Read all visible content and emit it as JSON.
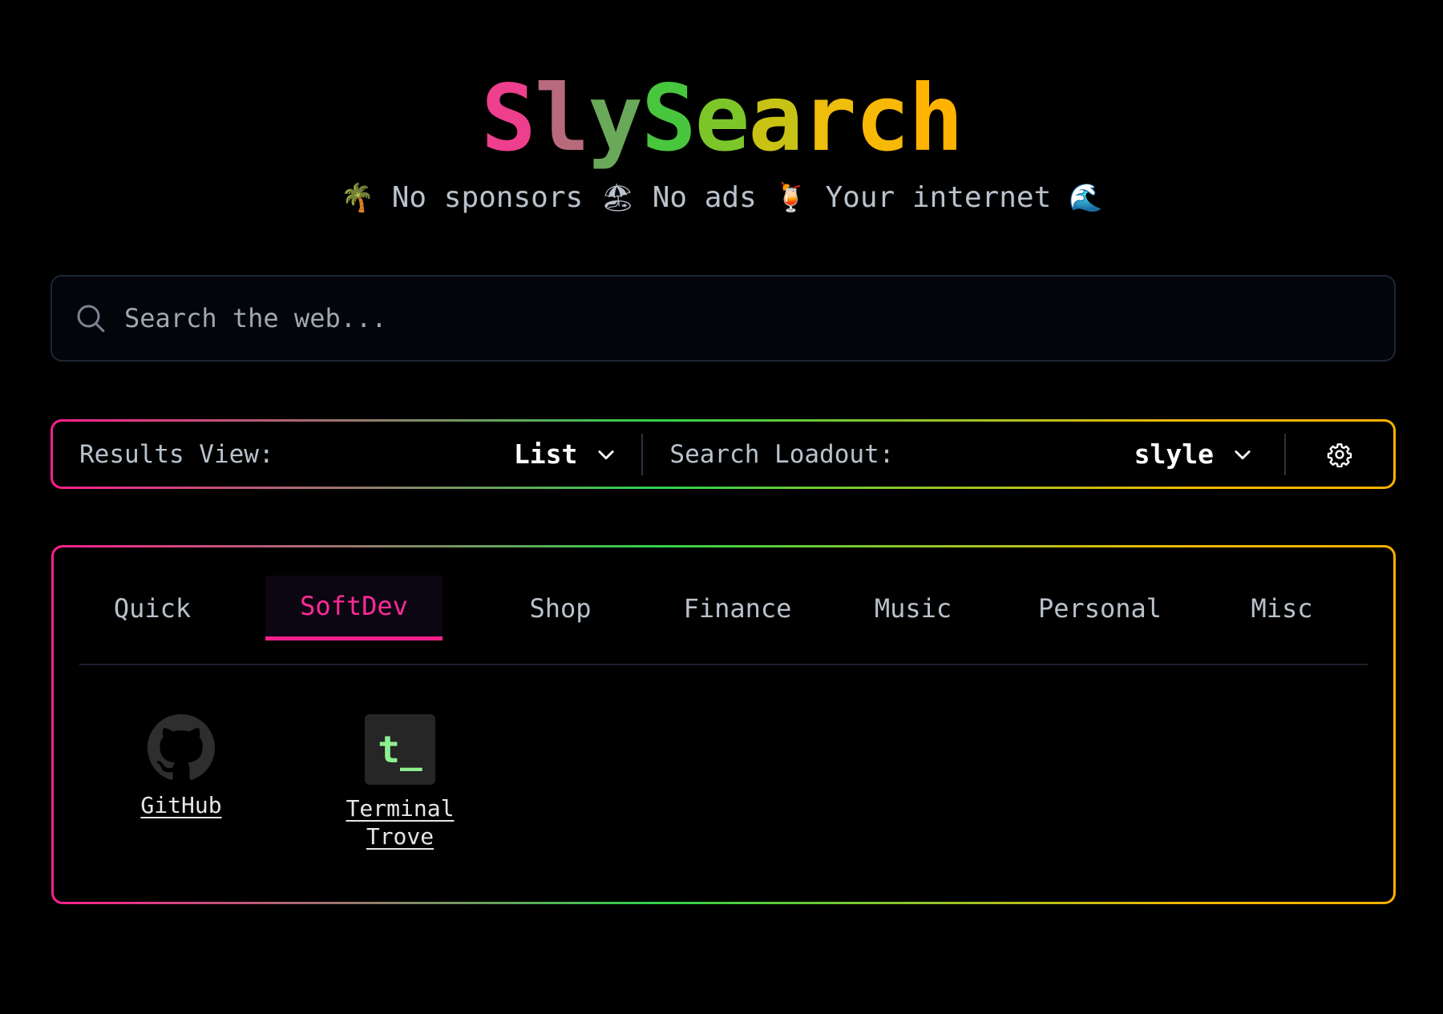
{
  "header": {
    "title_letters": [
      {
        "ch": "S",
        "color": "#ee3e8e"
      },
      {
        "ch": "l",
        "color": "#b86a7c"
      },
      {
        "ch": "y",
        "color": "#6aa85a"
      },
      {
        "ch": "S",
        "color": "#47c63e"
      },
      {
        "ch": "e",
        "color": "#7cc62a"
      },
      {
        "ch": "a",
        "color": "#c8c214"
      },
      {
        "ch": "r",
        "color": "#efbd0b"
      },
      {
        "ch": "c",
        "color": "#f8b806"
      },
      {
        "ch": "h",
        "color": "#ffb300"
      }
    ],
    "tagline": {
      "emoji1": "🌴",
      "text1": "No sponsors",
      "emoji2": "🏖",
      "text2": "No ads",
      "emoji3": "🍹",
      "text3": "Your internet",
      "emoji4": "🌊"
    }
  },
  "search": {
    "placeholder": "Search the web...",
    "icon": "search-icon"
  },
  "toolbar": {
    "results_view_label": "Results View:",
    "results_view_value": "List",
    "loadout_label": "Search Loadout:",
    "loadout_value": "slyle",
    "settings_icon": "gear-icon"
  },
  "tabs": [
    {
      "label": "Quick"
    },
    {
      "label": "SoftDev",
      "active": true
    },
    {
      "label": "Shop"
    },
    {
      "label": "Finance"
    },
    {
      "label": "Music"
    },
    {
      "label": "Personal"
    },
    {
      "label": "Misc"
    }
  ],
  "sites": [
    {
      "label": "GitHub",
      "icon": "github-icon"
    },
    {
      "label_line1": "Terminal",
      "label_line2": "Trove",
      "icon": "terminal-trove-icon",
      "icon_text": "t_"
    }
  ],
  "colors": {
    "accent_pink": "#ff1f8e",
    "accent_green": "#2fd14a",
    "accent_gold": "#ffb000"
  }
}
